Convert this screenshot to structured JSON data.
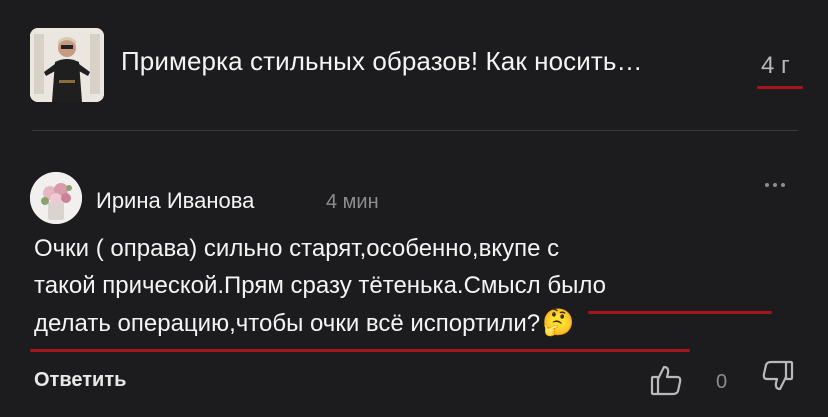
{
  "video": {
    "title": "Примерка стильных образов! Как носить…",
    "age": "4 г"
  },
  "comment": {
    "author": "Ирина Иванова",
    "time": "4 мин",
    "lines": [
      "Очки ( оправа) сильно старят,особенно,вкупе с",
      "такой прической.Прям сразу тётенька.Смысл было",
      "делать операцию,чтобы очки всё испортили?"
    ],
    "emoji": "🤔",
    "reply_label": "Ответить",
    "likes": "0"
  },
  "icons": [
    "more-options-icon",
    "thumbs-up-icon",
    "thumbs-down-icon",
    "thinking-face-icon"
  ],
  "colors": {
    "background": "#1c1c1e",
    "annotation_underline": "#a5161d",
    "secondary_text": "#8c8c8e"
  }
}
